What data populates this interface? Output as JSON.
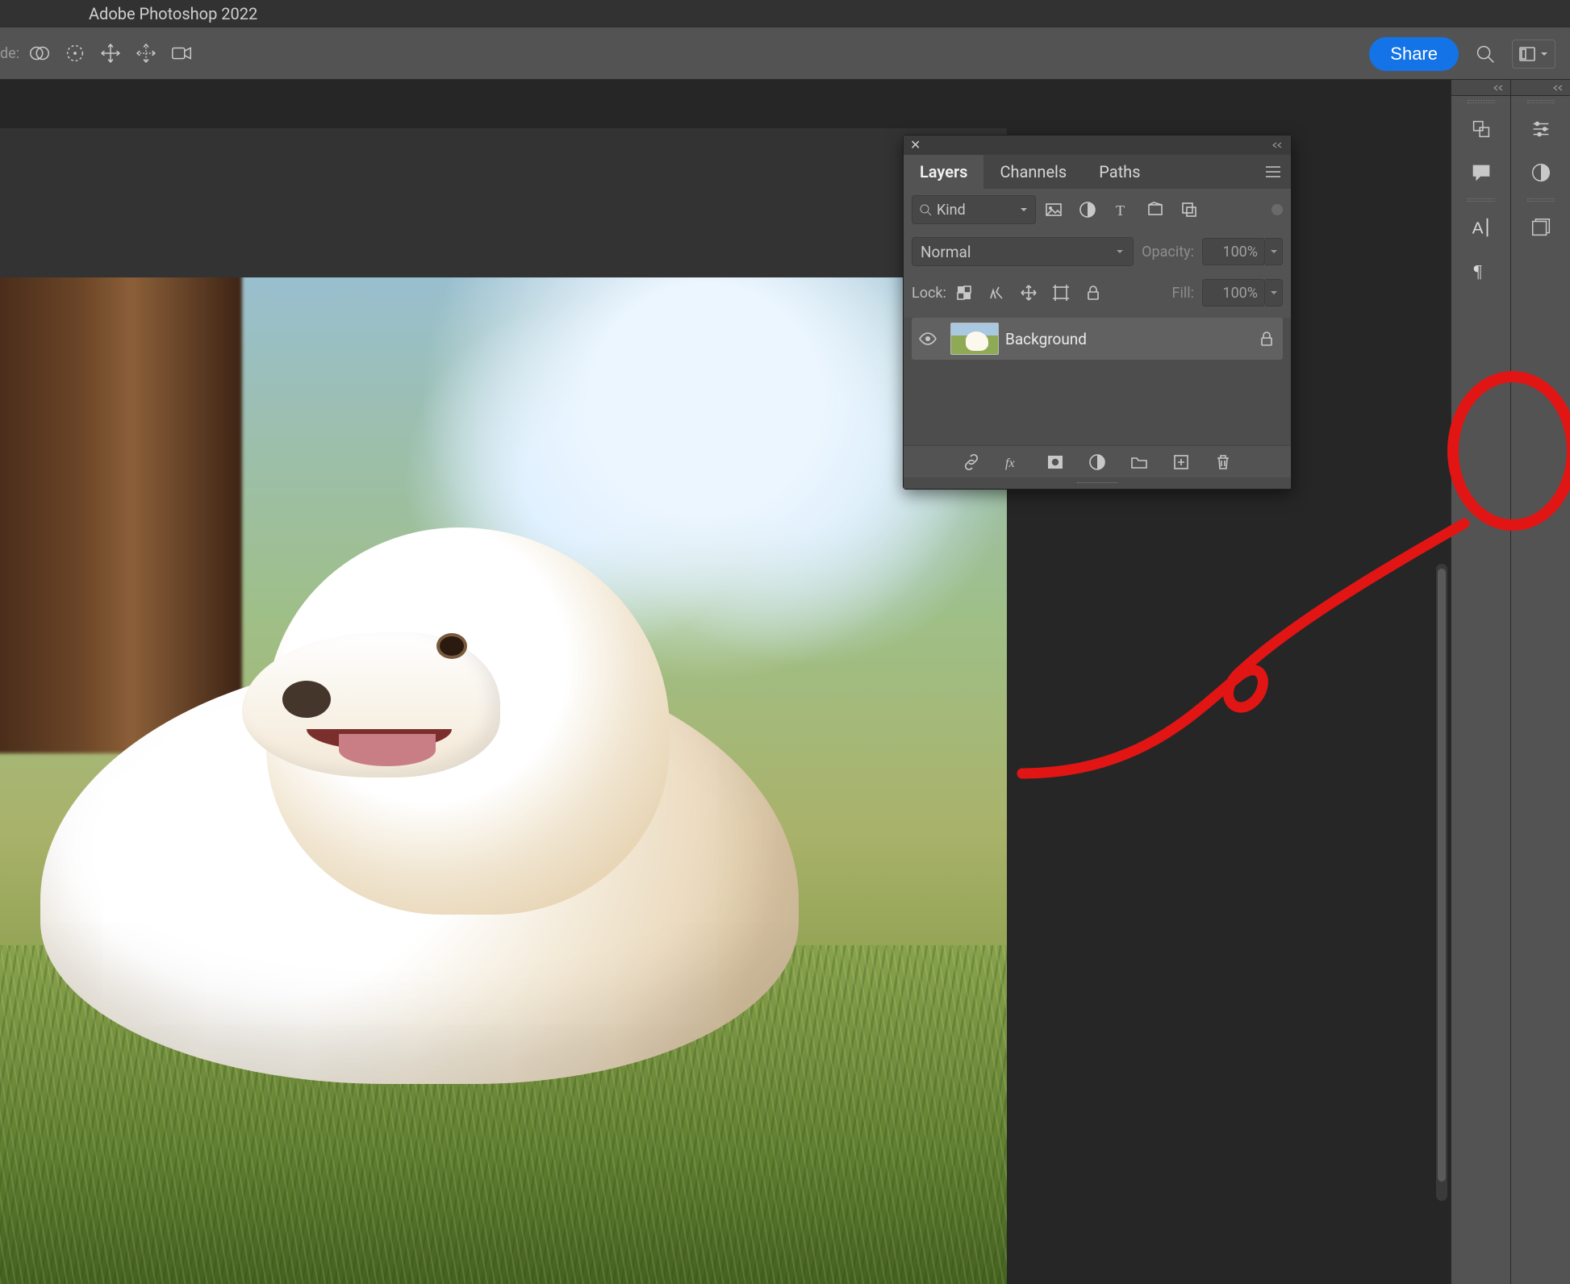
{
  "app_title": "Adobe Photoshop 2022",
  "options_bar": {
    "mode_label_fragment": "de:",
    "share_label": "Share"
  },
  "layers_panel": {
    "tabs": [
      "Layers",
      "Channels",
      "Paths"
    ],
    "active_tab": "Layers",
    "filter": {
      "kind_label": "Kind"
    },
    "blend_mode": "Normal",
    "opacity_label": "Opacity:",
    "opacity_value": "100%",
    "lock_label": "Lock:",
    "fill_label": "Fill:",
    "fill_value": "100%",
    "layers": [
      {
        "name": "Background",
        "visible": true,
        "locked": true
      }
    ]
  },
  "right_panels": {
    "colA_icons": [
      "color-swatch-icon",
      "comment-icon",
      "character-icon",
      "paragraph-icon"
    ],
    "colB_icons": [
      "adjustments-icon",
      "half-circle-icon",
      "libraries-icon"
    ]
  }
}
